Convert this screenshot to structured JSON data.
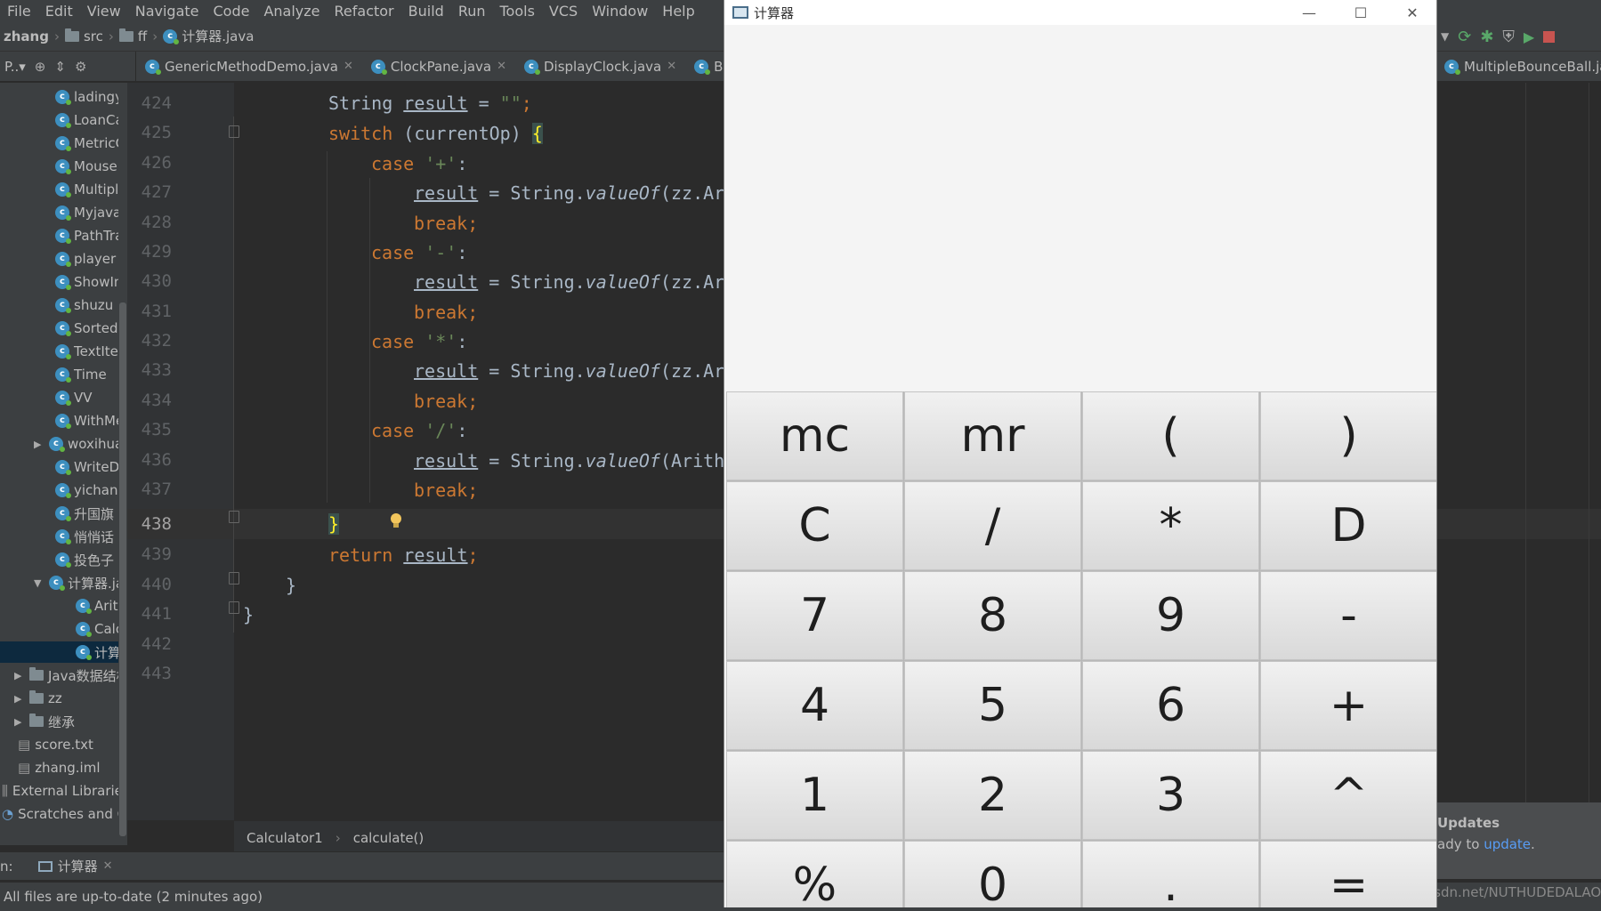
{
  "ide": {
    "menu": [
      "File",
      "Edit",
      "View",
      "Navigate",
      "Code",
      "Analyze",
      "Refactor",
      "Build",
      "Run",
      "Tools",
      "VCS",
      "Window",
      "Help"
    ],
    "menu_ghost": "zhan",
    "breadcrumb": [
      "zhang",
      "src",
      "ff",
      "计算器.java"
    ],
    "project_label": "P..▾",
    "tabs": [
      "GenericMethodDemo.java",
      "ClockPane.java",
      "DisplayClock.java",
      "Ball"
    ],
    "right_tab": "MultipleBounceBall.java",
    "tree": [
      "ladingyu",
      "LoanCalc",
      "MetricCo",
      "MouseE",
      "Multiple",
      "Myjavaf",
      "PathTran",
      "player",
      "ShowIma",
      "shuzu",
      "Sorted",
      "TextItera",
      "Time",
      "VV",
      "WithMe",
      "woxihua",
      "WriteDa",
      "yichang",
      "升国旗",
      "悄悄话",
      "投色子",
      "计算器.ja",
      "Arith",
      "Calcu",
      "计算器",
      "Java数据结构",
      "zz",
      "继承",
      "score.txt",
      "zhang.iml",
      "External Libraries",
      "Scratches and Co"
    ],
    "line_numbers": [
      "424",
      "425",
      "426",
      "427",
      "428",
      "429",
      "430",
      "431",
      "432",
      "433",
      "434",
      "435",
      "436",
      "437",
      "438",
      "439",
      "440",
      "441",
      "442",
      "443"
    ],
    "current_line": "438",
    "code": {
      "l424a": "String ",
      "l424b": "result",
      "l424c": " = ",
      "l424d": "\"\"",
      "l424e": ";",
      "l425a": "switch",
      "l425b": " (currentOp) ",
      "l425c": "{",
      "case": "case",
      "plus": " '+'",
      "minus": " '-'",
      "times": " '*'",
      "div": " '/'",
      "colon": ":",
      "res": "result",
      "assign": " = String.",
      "valueOf": "valueOf",
      "zzar": "(zz.Ar",
      "arith": "(Arith",
      "brk": "break",
      "semi": ";",
      "close_brace": "}",
      "ret": "return ",
      "ret_res": "result",
      "close2": "}",
      "close3": "}"
    },
    "editor_breadcrumb": [
      "Calculator1",
      "calculate()"
    ],
    "run_label": "n:",
    "run_tab": "计算器",
    "status": "All files are up-to-date (2 minutes ago)",
    "notification": {
      "title": "Updates",
      "text": "ady to ",
      "link": "update",
      "tail": "."
    },
    "watermark": "https://blog.csdn.net/NUTHUDEDALAO"
  },
  "calculator": {
    "title": "计算器",
    "display": "",
    "keys": [
      "mc",
      "mr",
      "(",
      ")",
      "C",
      "/",
      "*",
      "D",
      "7",
      "8",
      "9",
      "-",
      "4",
      "5",
      "6",
      "+",
      "1",
      "2",
      "3",
      "^",
      "%",
      "0",
      ".",
      "="
    ]
  },
  "colors": {
    "keyword": "#cc7832",
    "string": "#6a8759",
    "text": "#a9b7c6",
    "ide_bg": "#2b2b2b",
    "panel": "#3c3f41"
  }
}
